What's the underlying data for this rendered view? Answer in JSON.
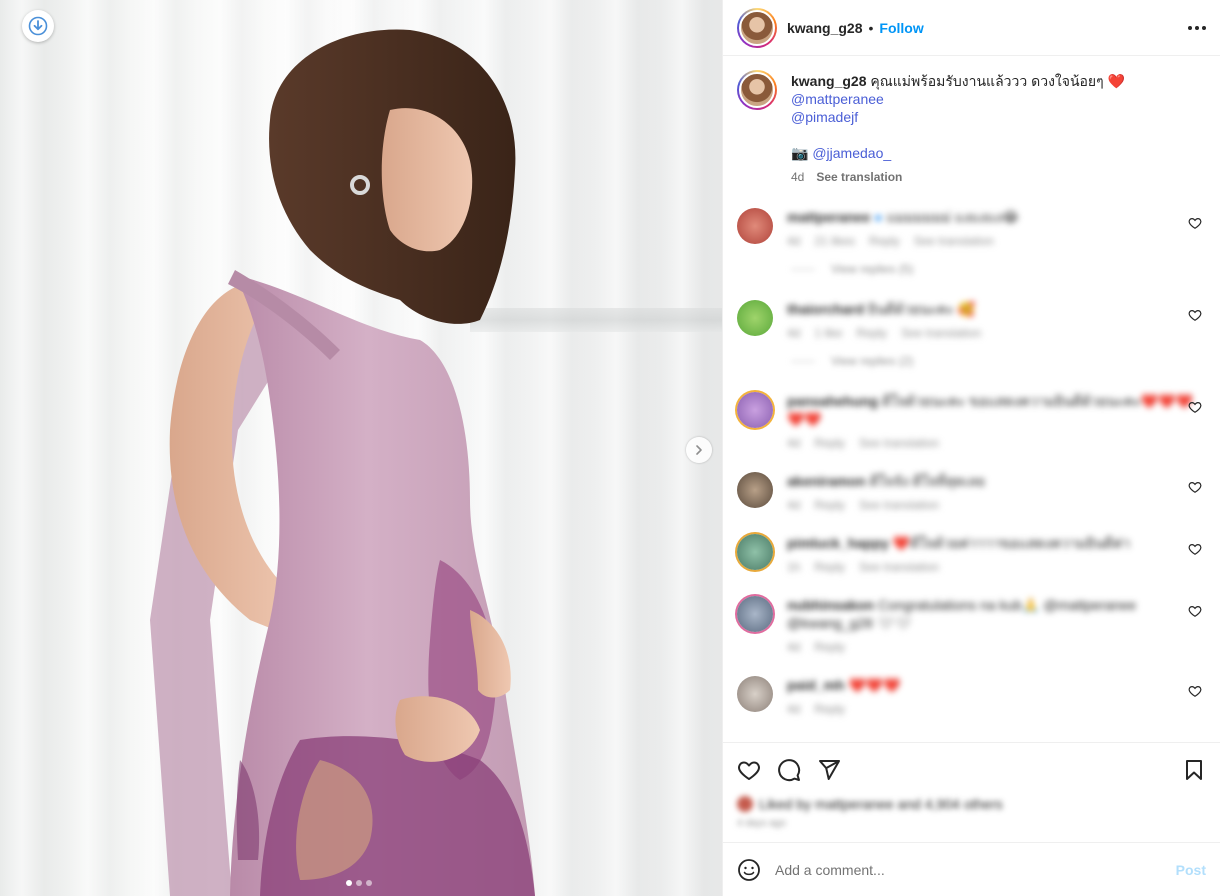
{
  "header": {
    "username": "kwang_g28",
    "separator": "•",
    "follow_label": "Follow"
  },
  "caption": {
    "username": "kwang_g28",
    "text": "คุณแม่พร้อมรับงานแล้ววว ดวงใจน้อยๆ",
    "emoji": "❤️",
    "mention_1": "@mattperanee",
    "mention_2": "@pimadejf",
    "camera_emoji": "📷",
    "photo_credit": "@jjamedao_",
    "age": "4d",
    "see_translation": "See translation"
  },
  "comments": [
    {
      "username": "mattperanee",
      "text": "แมมมมมม่ แงแงแง😂",
      "age": "4d",
      "likes": "21 likes",
      "reply": "Reply",
      "translate": "See translation",
      "view_replies": "View replies (5)"
    },
    {
      "username": "thaiorchard",
      "text": "ยินดีด้วยนะคะ 🥰",
      "age": "4d",
      "likes": "1 like",
      "reply": "Reply",
      "translate": "See translation",
      "view_replies": "View replies (2)"
    },
    {
      "username": "pansahehung",
      "text": "ดีใจด้วยนะคะ ขอแสดงความยินดีด้วยนะคะ❤️❤️❤️❤️❤️",
      "age": "4d",
      "reply": "Reply",
      "translate": "See translation"
    },
    {
      "username": "akeniramon",
      "text": "ดีใจจัง ดีใจที่สุดเลย",
      "age": "4d",
      "reply": "Reply",
      "translate": "See translation"
    },
    {
      "username": "pimluck_happy",
      "text": "❤️ดีใจด้วยค่าาาาขอแสดงความยินดีค่า",
      "age": "1h",
      "reply": "Reply",
      "translate": "See translation"
    },
    {
      "username": "nubhinsakon",
      "text": "Congratulations na kub🙏 @mattperanee @kwang_g28 🤍🤍",
      "age": "4d",
      "reply": "Reply"
    },
    {
      "username": "paid_mh",
      "text": "❤️❤️❤️",
      "age": "4d",
      "reply": "Reply"
    }
  ],
  "likes": {
    "text": "Liked by mattperanee and 4,904 others",
    "date": "4 days ago"
  },
  "comment_bar": {
    "placeholder": "Add a comment...",
    "post_label": "Post"
  },
  "colors": {
    "link_blue": "#0095f6",
    "mention_blue": "#4a5ed6",
    "post_disabled": "#b2dffc",
    "dress_lilac": "#c9a0b8"
  },
  "carousel": {
    "current_index": 1,
    "total": 3
  }
}
